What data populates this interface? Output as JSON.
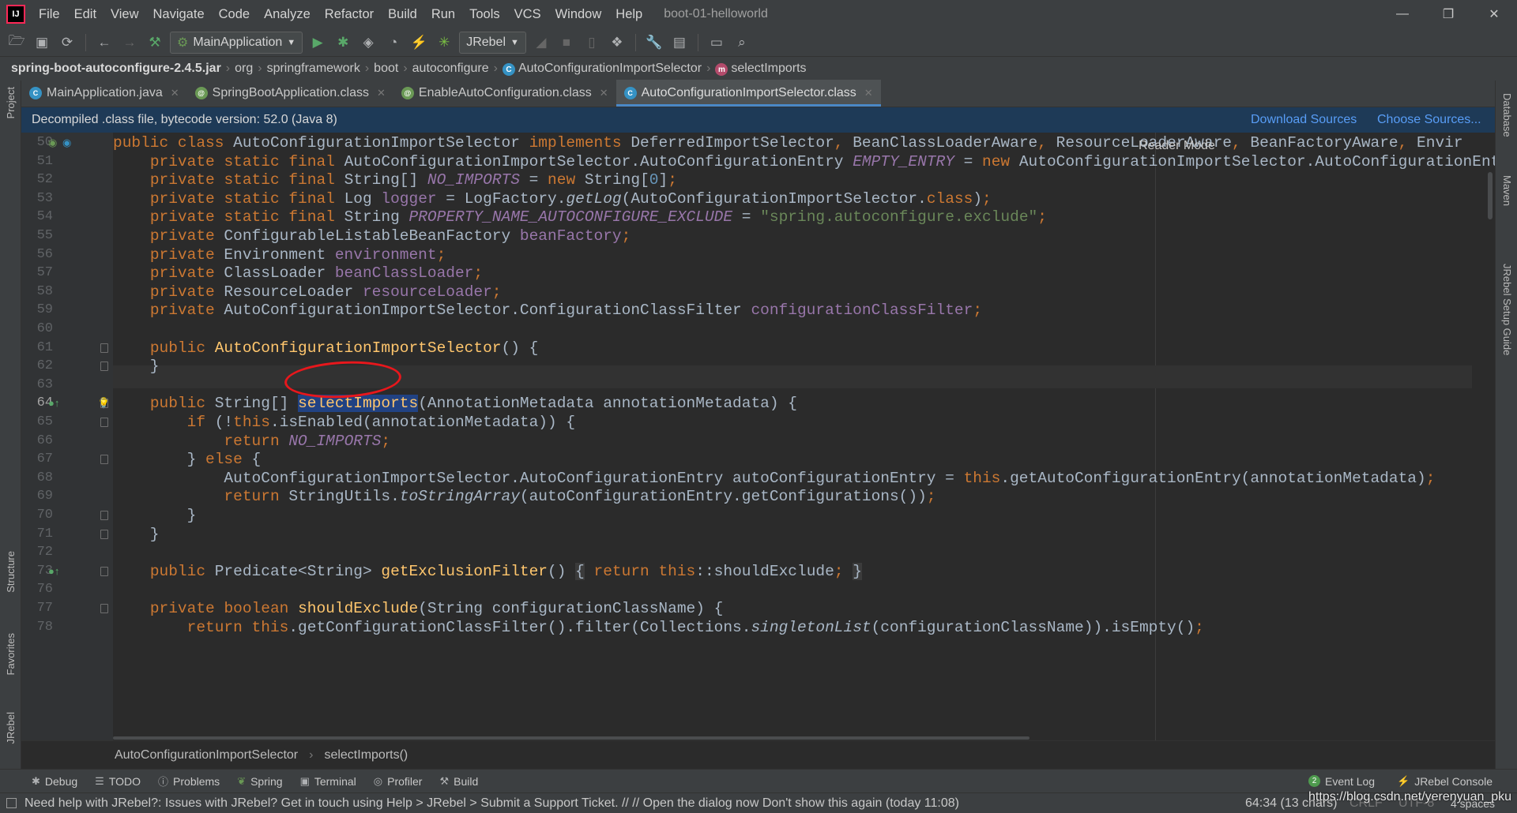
{
  "app": {
    "logo_text": "IJ",
    "menu": [
      "File",
      "Edit",
      "View",
      "Navigate",
      "Code",
      "Analyze",
      "Refactor",
      "Build",
      "Run",
      "Tools",
      "VCS",
      "Window",
      "Help"
    ],
    "project_title": "boot-01-helloworld",
    "window_controls": {
      "minimize": "—",
      "restore": "❐",
      "close": "✕"
    }
  },
  "toolbar": {
    "run_config": "MainApplication",
    "jrebel_label": "JRebel",
    "icons": [
      "open-folder-icon",
      "save-icon",
      "sync-icon",
      "back-icon",
      "forward-icon",
      "build-hammer-icon",
      "run-icon",
      "debug-icon",
      "coverage-icon",
      "profile-icon",
      "jrebel-run-icon",
      "jrebel-debug-icon",
      "stop-icon",
      "settings-icon",
      "search-icon"
    ]
  },
  "breadcrumbs": [
    "spring-boot-autoconfigure-2.4.5.jar",
    "org",
    "springframework",
    "boot",
    "autoconfigure",
    "AutoConfigurationImportSelector",
    "selectImports"
  ],
  "tabs": [
    {
      "label": "MainApplication.java",
      "active": false,
      "color": "#3592c4"
    },
    {
      "label": "SpringBootApplication.class",
      "active": false,
      "color": "#6a9955"
    },
    {
      "label": "EnableAutoConfiguration.class",
      "active": false,
      "color": "#6a9955"
    },
    {
      "label": "AutoConfigurationImportSelector.class",
      "active": true,
      "color": "#3592c4"
    }
  ],
  "banner": {
    "text": "Decompiled .class file, bytecode version: 52.0 (Java 8)",
    "download_sources": "Download Sources",
    "choose_sources": "Choose Sources..."
  },
  "editor": {
    "reader_mode": "Reader Mode",
    "current_line": 64,
    "lines": [
      {
        "n": "50",
        "code": "public class AutoConfigurationImportSelector implements DeferredImportSelector, BeanClassLoaderAware, ResourceLoaderAware, BeanFactoryAware, Envir"
      },
      {
        "n": "51",
        "code": "    private static final AutoConfigurationImportSelector.AutoConfigurationEntry EMPTY_ENTRY = new AutoConfigurationImportSelector.AutoConfigurationEntry();"
      },
      {
        "n": "52",
        "code": "    private static final String[] NO_IMPORTS = new String[0];"
      },
      {
        "n": "53",
        "code": "    private static final Log logger = LogFactory.getLog(AutoConfigurationImportSelector.class);"
      },
      {
        "n": "54",
        "code": "    private static final String PROPERTY_NAME_AUTOCONFIGURE_EXCLUDE = \"spring.autoconfigure.exclude\";"
      },
      {
        "n": "55",
        "code": "    private ConfigurableListableBeanFactory beanFactory;"
      },
      {
        "n": "56",
        "code": "    private Environment environment;"
      },
      {
        "n": "57",
        "code": "    private ClassLoader beanClassLoader;"
      },
      {
        "n": "58",
        "code": "    private ResourceLoader resourceLoader;"
      },
      {
        "n": "59",
        "code": "    private AutoConfigurationImportSelector.ConfigurationClassFilter configurationClassFilter;"
      },
      {
        "n": "60",
        "code": ""
      },
      {
        "n": "61",
        "code": "    public AutoConfigurationImportSelector() {"
      },
      {
        "n": "62",
        "code": "    }"
      },
      {
        "n": "63",
        "code": ""
      },
      {
        "n": "64",
        "code": "    public String[] selectImports(AnnotationMetadata annotationMetadata) {"
      },
      {
        "n": "65",
        "code": "        if (!this.isEnabled(annotationMetadata)) {"
      },
      {
        "n": "66",
        "code": "            return NO_IMPORTS;"
      },
      {
        "n": "67",
        "code": "        } else {"
      },
      {
        "n": "68",
        "code": "            AutoConfigurationImportSelector.AutoConfigurationEntry autoConfigurationEntry = this.getAutoConfigurationEntry(annotationMetadata);"
      },
      {
        "n": "69",
        "code": "            return StringUtils.toStringArray(autoConfigurationEntry.getConfigurations());"
      },
      {
        "n": "70",
        "code": "        }"
      },
      {
        "n": "71",
        "code": "    }"
      },
      {
        "n": "72",
        "code": ""
      },
      {
        "n": "73",
        "code": "    public Predicate<String> getExclusionFilter() { return this::shouldExclude; }"
      },
      {
        "n": "76",
        "code": ""
      },
      {
        "n": "77",
        "code": "    private boolean shouldExclude(String configurationClassName) {"
      },
      {
        "n": "78",
        "code": "        return this.getConfigurationClassFilter().filter(Collections.singletonList(configurationClassName)).isEmpty();"
      }
    ]
  },
  "editor_crumb": [
    "AutoConfigurationImportSelector",
    "selectImports()"
  ],
  "left_panels": [
    "Project",
    "Structure",
    "Favorites",
    "JRebel"
  ],
  "right_panels": [
    "Database",
    "Maven",
    "JRebel Setup Guide"
  ],
  "tool_windows": [
    "Debug",
    "TODO",
    "Problems",
    "Spring",
    "Terminal",
    "Profiler",
    "Build"
  ],
  "tool_windows_right": {
    "event_log": "Event Log",
    "event_log_count": "2",
    "jrebel_console": "JRebel Console"
  },
  "status": {
    "message": "Need help with JRebel?: Issues with JRebel? Get in touch using Help > JRebel > Submit a Support Ticket. // // Open the dialog now     Don't show this again (today 11:08)",
    "position": "64:34 (13 chars)",
    "line_sep": "CRLF",
    "encoding": "UTF-8",
    "indent": "4 spaces",
    "watermark": "https://blog.csdn.net/yerenyuan_pku"
  }
}
